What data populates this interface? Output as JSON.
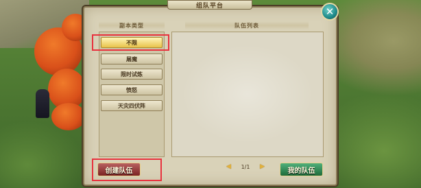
{
  "window": {
    "title": "组队平台"
  },
  "left_column": {
    "header": "副本类型",
    "categories": [
      {
        "label": "不限",
        "selected": true
      },
      {
        "label": "屠魔",
        "selected": false
      },
      {
        "label": "限时试炼",
        "selected": false
      },
      {
        "label": "愤怒",
        "selected": false
      },
      {
        "label": "天灾四伏阵",
        "selected": false
      }
    ]
  },
  "right_column": {
    "header": "队伍列表"
  },
  "pagination": {
    "page_text": "1/1"
  },
  "buttons": {
    "create_label": "创建队伍",
    "my_team_label": "我的队伍"
  },
  "colors": {
    "highlight": "#e8323e",
    "selected_category": "#e8c34a",
    "create_button": "#7a2222",
    "my_team_button": "#1e6a3a"
  },
  "icons": {
    "close": "close-x-icon",
    "prev": "triangle-left-icon",
    "next": "triangle-right-icon"
  }
}
